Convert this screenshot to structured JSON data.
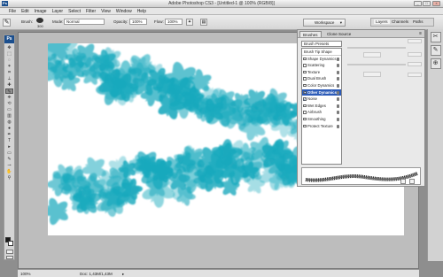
{
  "window": {
    "title": "Adobe Photoshop CS3 - [Untitled-1 @ 100% (RGB/8)]",
    "app_icon": "Ps",
    "minimize": "_",
    "maximize": "□",
    "close": "×"
  },
  "menu": [
    "File",
    "Edit",
    "Image",
    "Layer",
    "Select",
    "Filter",
    "View",
    "Window",
    "Help"
  ],
  "options": {
    "brush_label": "Brush:",
    "brush_size": "300",
    "mode_label": "Mode:",
    "mode_value": "Normal",
    "opacity_label": "Opacity:",
    "opacity_value": "100%",
    "flow_label": "Flow:",
    "flow_value": "100%",
    "workspace": "Workspace"
  },
  "panel_tabs": [
    "Layers",
    "Channels",
    "Paths"
  ],
  "toolbox": {
    "logo": "Ps",
    "tools": [
      "move-tool",
      "marquee-tool",
      "lasso-tool",
      "magic-wand-tool",
      "crop-tool",
      "slice-tool",
      "healing-tool",
      "brush-tool",
      "stamp-tool",
      "history-brush-tool",
      "eraser-tool",
      "gradient-tool",
      "blur-tool",
      "dodge-tool",
      "pen-tool",
      "type-tool",
      "path-select-tool",
      "shape-tool",
      "notes-tool",
      "eyedropper-tool",
      "hand-tool",
      "zoom-tool"
    ],
    "foreground_color": "#1a1a1a",
    "background_color": "#ffffff"
  },
  "brushes_panel": {
    "tabs": [
      "Brushes",
      "Clone Source"
    ],
    "presets_button": "Brush Presets",
    "options": [
      {
        "label": "Brush Tip Shape",
        "checked": false,
        "lock": false
      },
      {
        "label": "Shape Dynamics",
        "checked": false,
        "lock": true
      },
      {
        "label": "Scattering",
        "checked": false,
        "lock": true
      },
      {
        "label": "Texture",
        "checked": false,
        "lock": true
      },
      {
        "label": "Dual Brush",
        "checked": false,
        "lock": true
      },
      {
        "label": "Color Dynamics",
        "checked": false,
        "lock": true
      },
      {
        "label": "Other Dynamics",
        "checked": true,
        "lock": true,
        "selected": true
      },
      {
        "label": "Noise",
        "checked": true,
        "lock": true
      },
      {
        "label": "Wet Edges",
        "checked": false,
        "lock": true
      },
      {
        "label": "Airbrush",
        "checked": false,
        "lock": true
      },
      {
        "label": "Smoothing",
        "checked": false,
        "lock": true
      },
      {
        "label": "Protect Texture",
        "checked": false,
        "lock": true
      }
    ]
  },
  "status": {
    "zoom": "100%",
    "doc": "Doc: 1,43M/1,43M"
  },
  "colors": {
    "brush_cyan": "#1aa9bd",
    "selection_blue": "#2c5bb8"
  }
}
